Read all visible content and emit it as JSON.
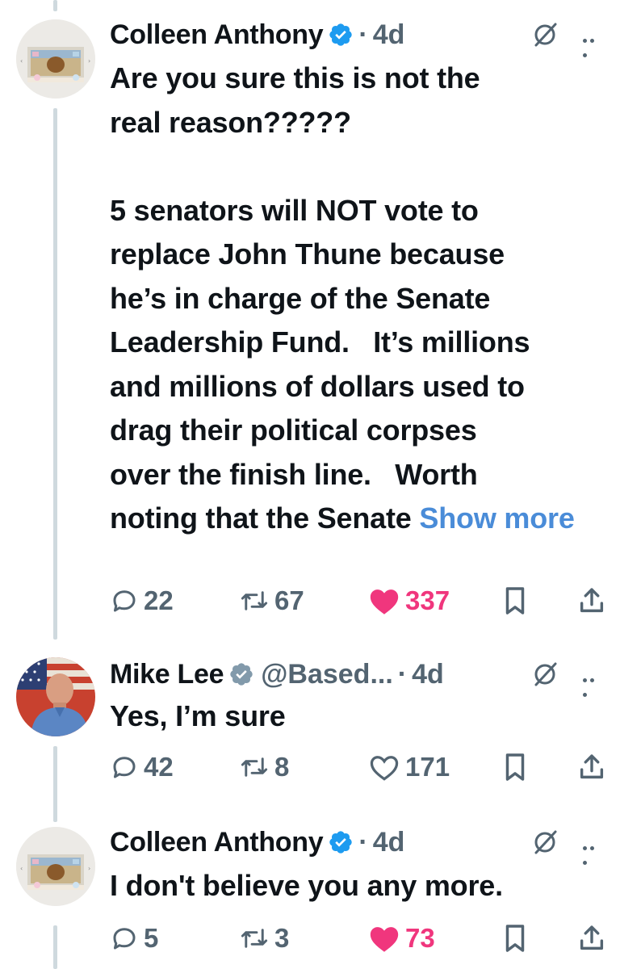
{
  "tweets": [
    {
      "name": "Colleen Anthony",
      "verified": true,
      "handle": "",
      "time": "4d",
      "text_lines": [
        "Are you sure this is not the",
        "real reason?????",
        "",
        "5 senators will NOT vote to",
        "replace John Thune because",
        "he’s in charge of the Senate",
        "Leadership Fund.   It’s millions",
        "and millions of dollars used to",
        "drag their political corpses",
        "over the finish line.   Worth",
        "noting that the Senate"
      ],
      "show_more": "Show more",
      "replies": "22",
      "reposts": "67",
      "likes": "337",
      "liked": true
    },
    {
      "name": "Mike Lee",
      "verified": true,
      "handle": "@Based...",
      "time": "4d",
      "text": "Yes, I’m sure",
      "replies": "42",
      "reposts": "8",
      "likes": "171",
      "liked": false
    },
    {
      "name": "Colleen Anthony",
      "verified": true,
      "handle": "",
      "time": "4d",
      "text": "I don't believe you any more.",
      "replies": "5",
      "reposts": "3",
      "likes": "73",
      "liked": true
    }
  ],
  "icons": {
    "reply": "speech-bubble-icon",
    "repost": "repost-arrows-icon",
    "like": "heart-icon",
    "bookmark": "bookmark-icon",
    "share": "share-upload-icon",
    "grok": "grok-slash-icon",
    "more": "more-dots-icon",
    "verified": "verified-badge-icon"
  },
  "colors": {
    "text": "#0f1419",
    "secondary": "#536471",
    "link": "#4a8cd8",
    "like": "#f0367d",
    "verified": "#1d9bf0",
    "verified_gray": "#829aab",
    "thread_line": "#cfd9de"
  }
}
